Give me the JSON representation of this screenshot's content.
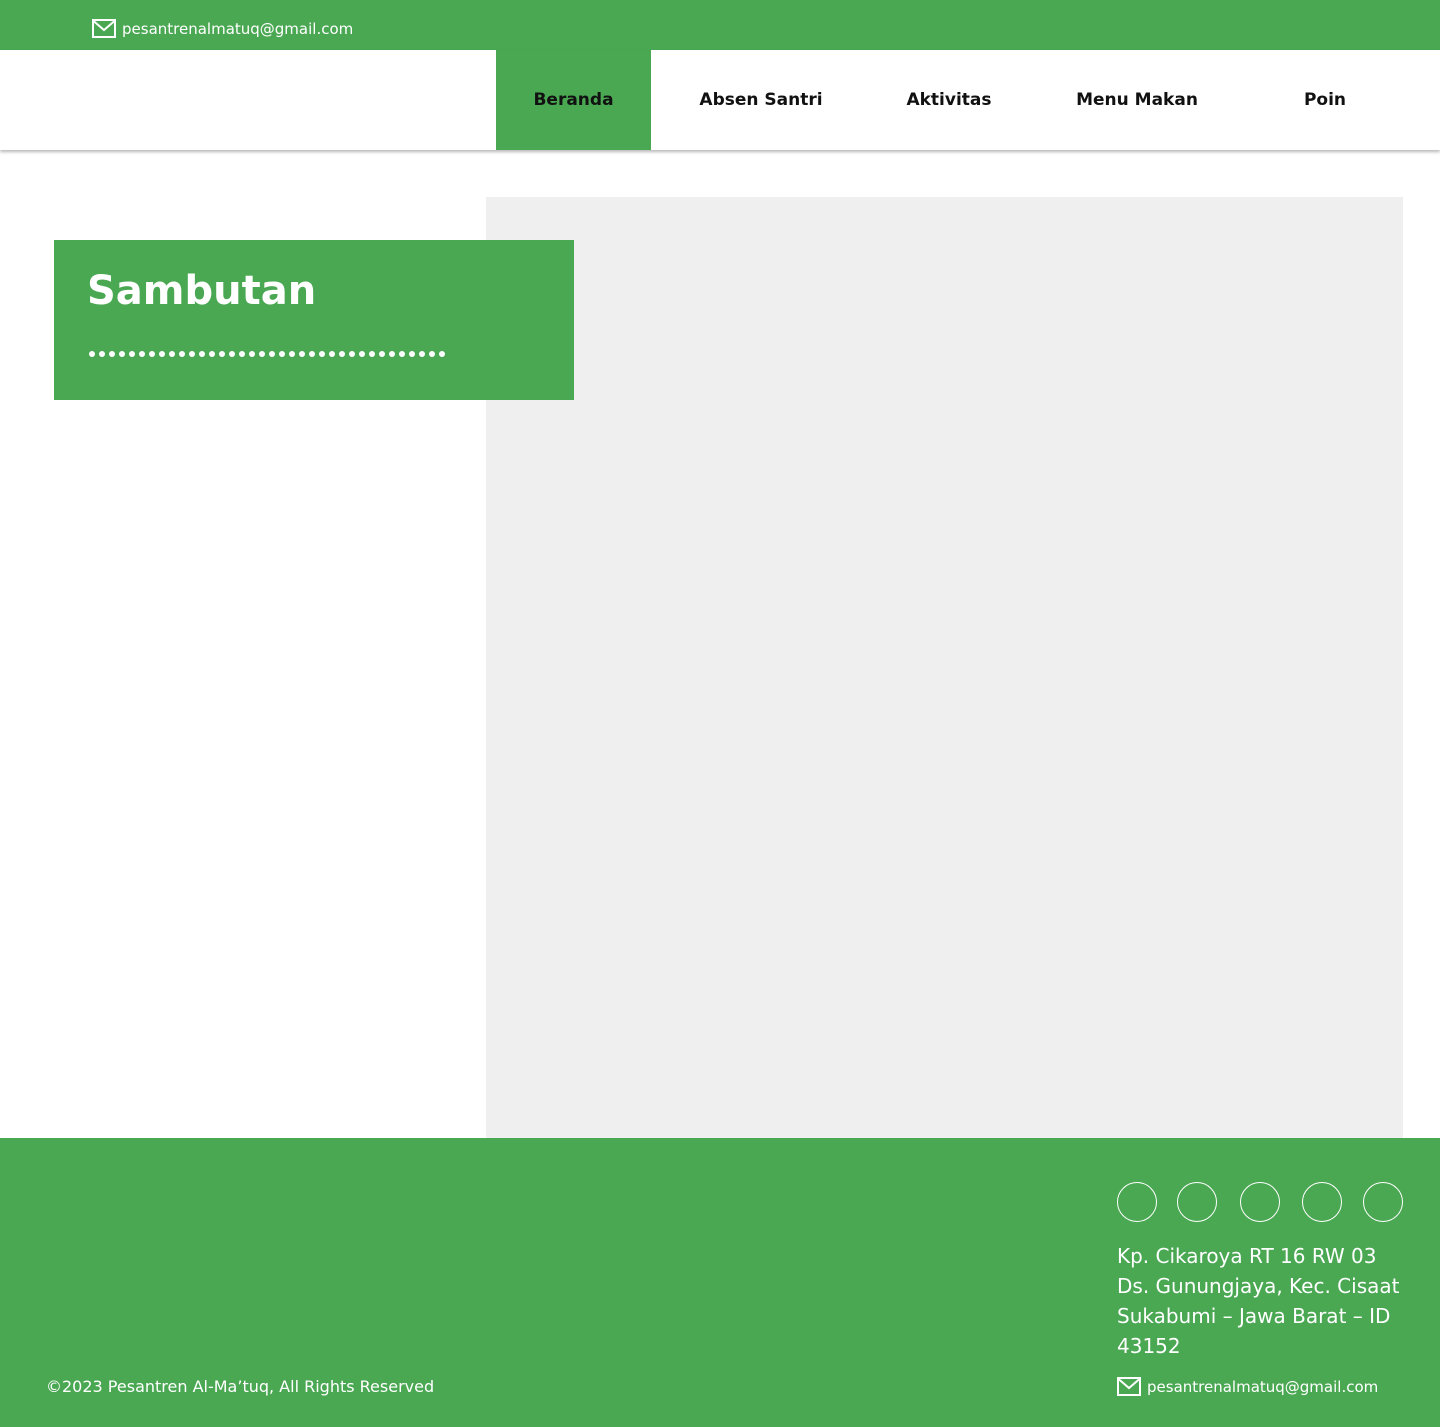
{
  "colors": {
    "brand_green": "#4aa853",
    "placeholder_gray": "#efefef",
    "nav_text": "#111111",
    "light_text": "#ffffff"
  },
  "topbar": {
    "email": "pesantrenalmatuq@gmail.com",
    "email_icon": "mail-icon"
  },
  "nav": {
    "items": [
      {
        "label": "Beranda",
        "active": true
      },
      {
        "label": "Absen Santri",
        "active": false
      },
      {
        "label": "Aktivitas",
        "active": false
      },
      {
        "label": "Menu Makan",
        "active": false
      },
      {
        "label": "Poin",
        "active": false
      }
    ]
  },
  "hero": {
    "title": "Sambutan",
    "dot_count": 36
  },
  "footer": {
    "social_icons": [
      "social-icon-1",
      "social-icon-2",
      "social-icon-3",
      "social-icon-4",
      "social-icon-5"
    ],
    "address_lines": [
      "Kp. Cikaroya RT 16 RW 03",
      "Ds. Gunungjaya, Kec. Cisaat",
      "Sukabumi – Jawa Barat – ID",
      "43152"
    ],
    "email": "pesantrenalmatuq@gmail.com",
    "copyright": "©2023 Pesantren Al-Ma’tuq, All Rights Reserved"
  }
}
